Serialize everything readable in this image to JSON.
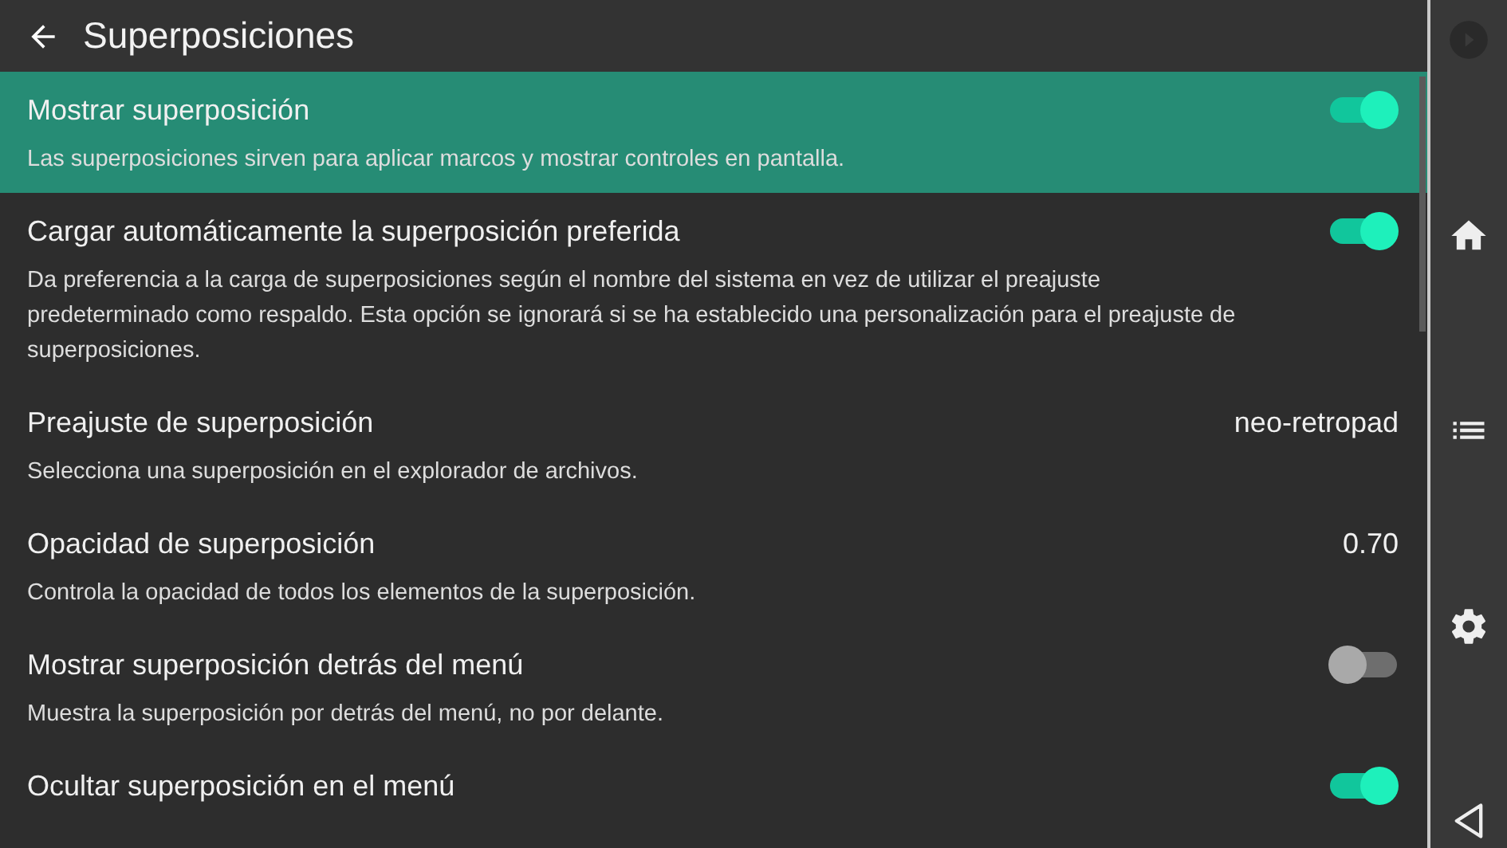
{
  "header": {
    "title": "Superposiciones"
  },
  "settings": [
    {
      "kind": "toggle",
      "title": "Mostrar superposición",
      "description": "Las superposiciones sirven para aplicar marcos y mostrar controles en pantalla.",
      "on": true,
      "selected": true
    },
    {
      "kind": "toggle",
      "title": "Cargar automáticamente la superposición preferida",
      "description": "Da preferencia a la carga de superposiciones según el nombre del sistema en vez de utilizar el preajuste predeterminado como respaldo. Esta opción se ignorará si se ha establecido una personalización para el preajuste de superposiciones.",
      "on": true,
      "selected": false
    },
    {
      "kind": "value",
      "title": "Preajuste de superposición",
      "description": "Selecciona una superposición en el explorador de archivos.",
      "value": "neo-retropad",
      "selected": false
    },
    {
      "kind": "value",
      "title": "Opacidad de superposición",
      "description": "Controla la opacidad de todos los elementos de la superposición.",
      "value": "0.70",
      "selected": false
    },
    {
      "kind": "toggle",
      "title": "Mostrar superposición detrás del menú",
      "description": "Muestra la superposición por detrás del menú, no por delante.",
      "on": false,
      "selected": false
    },
    {
      "kind": "toggle",
      "title": "Ocultar superposición en el menú",
      "on": true,
      "selected": false
    }
  ]
}
